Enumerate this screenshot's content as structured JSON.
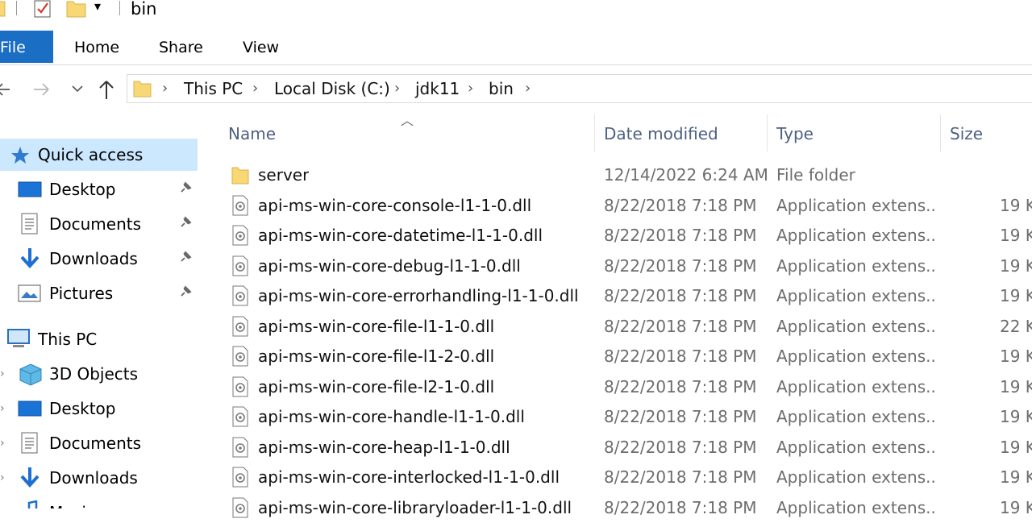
{
  "window": {
    "title": "bin"
  },
  "ribbon": {
    "tabs": [
      {
        "label": "File"
      },
      {
        "label": "Home"
      },
      {
        "label": "Share"
      },
      {
        "label": "View"
      }
    ]
  },
  "address": {
    "crumbs": [
      "This PC",
      "Local Disk (C:)",
      "jdk11",
      "bin"
    ]
  },
  "nav": {
    "quick_access": "Quick access",
    "qa_items": [
      "Desktop",
      "Documents",
      "Downloads",
      "Pictures"
    ],
    "this_pc": "This PC",
    "pc_items": [
      "3D Objects",
      "Desktop",
      "Documents",
      "Downloads",
      "Music"
    ]
  },
  "columns": {
    "name": "Name",
    "date": "Date modified",
    "type": "Type",
    "size": "Size"
  },
  "files": [
    {
      "name": "server",
      "date": "12/14/2022 6:24 AM",
      "type": "File folder",
      "size": "",
      "kind": "folder"
    },
    {
      "name": "api-ms-win-core-console-l1-1-0.dll",
      "date": "8/22/2018 7:18 PM",
      "type": "Application extens...",
      "size": "19 K",
      "kind": "dll"
    },
    {
      "name": "api-ms-win-core-datetime-l1-1-0.dll",
      "date": "8/22/2018 7:18 PM",
      "type": "Application extens...",
      "size": "19 K",
      "kind": "dll"
    },
    {
      "name": "api-ms-win-core-debug-l1-1-0.dll",
      "date": "8/22/2018 7:18 PM",
      "type": "Application extens...",
      "size": "19 K",
      "kind": "dll"
    },
    {
      "name": "api-ms-win-core-errorhandling-l1-1-0.dll",
      "date": "8/22/2018 7:18 PM",
      "type": "Application extens...",
      "size": "19 K",
      "kind": "dll"
    },
    {
      "name": "api-ms-win-core-file-l1-1-0.dll",
      "date": "8/22/2018 7:18 PM",
      "type": "Application extens...",
      "size": "22 K",
      "kind": "dll"
    },
    {
      "name": "api-ms-win-core-file-l1-2-0.dll",
      "date": "8/22/2018 7:18 PM",
      "type": "Application extens...",
      "size": "19 K",
      "kind": "dll"
    },
    {
      "name": "api-ms-win-core-file-l2-1-0.dll",
      "date": "8/22/2018 7:18 PM",
      "type": "Application extens...",
      "size": "19 K",
      "kind": "dll"
    },
    {
      "name": "api-ms-win-core-handle-l1-1-0.dll",
      "date": "8/22/2018 7:18 PM",
      "type": "Application extens...",
      "size": "19 K",
      "kind": "dll"
    },
    {
      "name": "api-ms-win-core-heap-l1-1-0.dll",
      "date": "8/22/2018 7:18 PM",
      "type": "Application extens...",
      "size": "19 K",
      "kind": "dll"
    },
    {
      "name": "api-ms-win-core-interlocked-l1-1-0.dll",
      "date": "8/22/2018 7:18 PM",
      "type": "Application extens...",
      "size": "19 K",
      "kind": "dll"
    },
    {
      "name": "api-ms-win-core-libraryloader-l1-1-0.dll",
      "date": "8/22/2018 7:18 PM",
      "type": "Application extens...",
      "size": "19 K",
      "kind": "dll"
    }
  ],
  "colors": {
    "accent": "#1a6ec3",
    "selection": "#cce8ff",
    "folder": "#f8d775",
    "header_text": "#4d6082"
  }
}
